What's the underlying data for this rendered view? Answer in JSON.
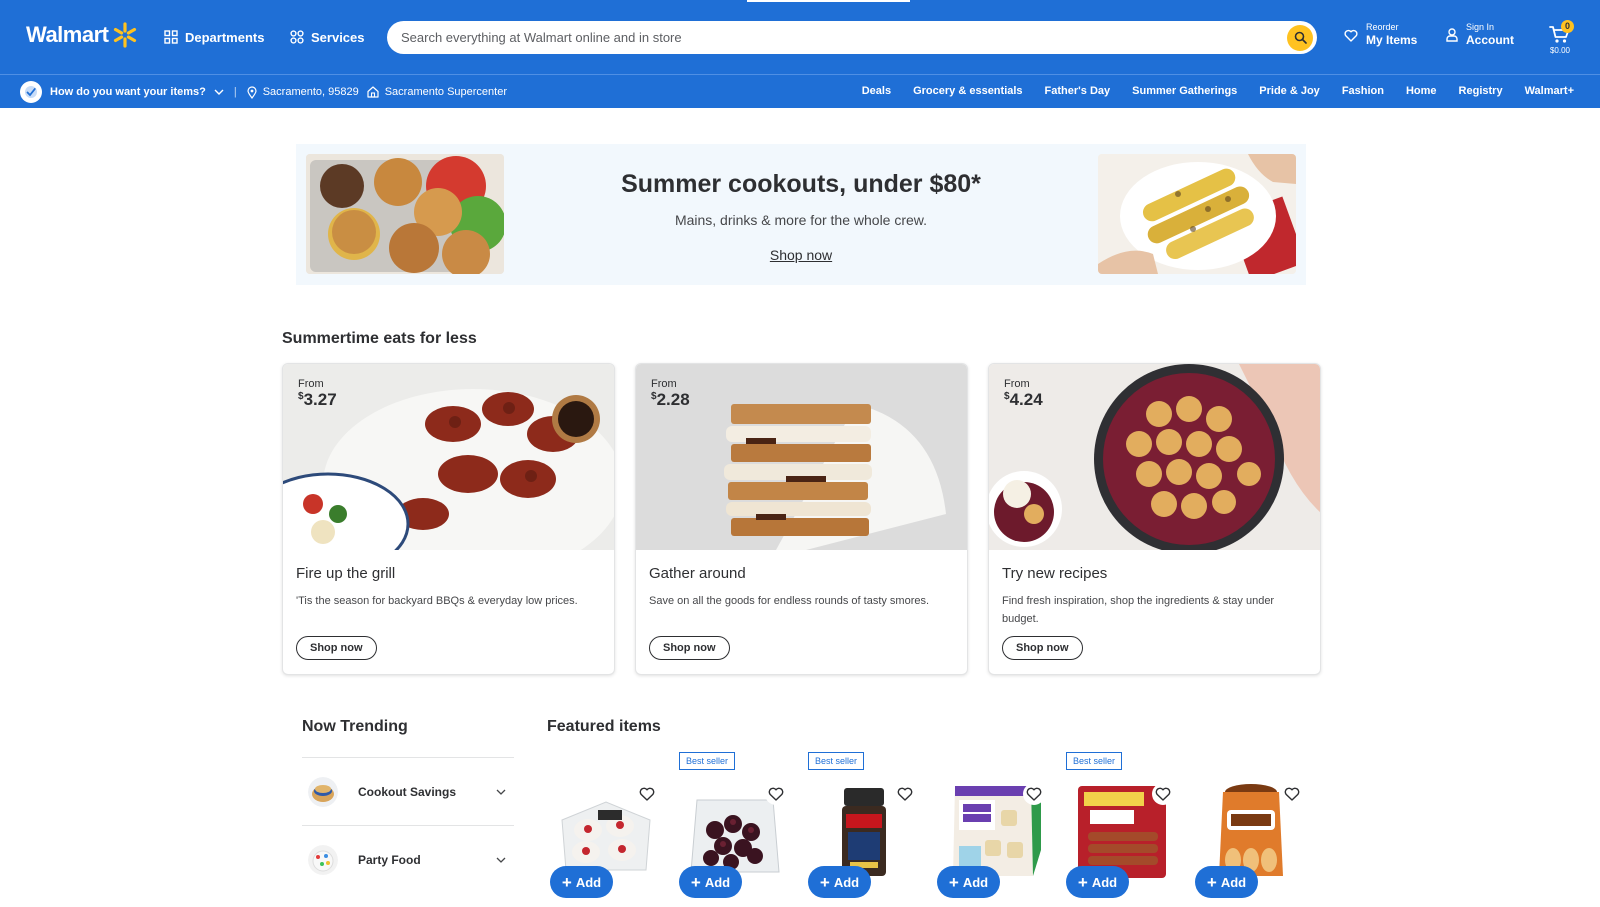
{
  "header": {
    "logo_text": "Walmart",
    "departments": "Departments",
    "services": "Services",
    "search_placeholder": "Search everything at Walmart online and in store",
    "reorder_small": "Reorder",
    "reorder_big": "My Items",
    "signin_small": "Sign In",
    "signin_big": "Account",
    "cart_count": "0",
    "cart_total": "$0.00",
    "brand_color": "#1f6fd6",
    "accent_color": "#ffc220"
  },
  "subbar": {
    "delivery_prompt": "How do you want your items?",
    "location": "Sacramento, 95829",
    "store": "Sacramento Supercenter",
    "nav": [
      "Deals",
      "Grocery & essentials",
      "Father's Day",
      "Summer Gatherings",
      "Pride & Joy",
      "Fashion",
      "Home",
      "Registry",
      "Walmart+"
    ]
  },
  "banner": {
    "title": "Summer cookouts, under $80*",
    "subtitle": "Mains, drinks & more for the whole crew.",
    "link": "Shop now"
  },
  "summertime": {
    "title": "Summertime eats for less",
    "cards": [
      {
        "from": "From",
        "currency": "$",
        "price": "3.27",
        "title": "Fire up the grill",
        "desc": "'Tis the season for backyard BBQs & everyday low prices.",
        "button": "Shop now"
      },
      {
        "from": "From",
        "currency": "$",
        "price": "2.28",
        "title": "Gather around",
        "desc": "Save on all the goods for endless rounds of tasty smores.",
        "button": "Shop now"
      },
      {
        "from": "From",
        "currency": "$",
        "price": "4.24",
        "title": "Try new recipes",
        "desc": "Find fresh inspiration, shop the ingredients & stay under budget.",
        "button": "Shop now"
      }
    ]
  },
  "trending": {
    "title": "Now Trending",
    "items": [
      {
        "label": "Cookout Savings"
      },
      {
        "label": "Party Food"
      }
    ]
  },
  "featured": {
    "title": "Featured items",
    "add_label": "Add",
    "products": [
      {
        "tag": ""
      },
      {
        "tag": "Best seller"
      },
      {
        "tag": "Best seller"
      },
      {
        "tag": ""
      },
      {
        "tag": "Best seller"
      },
      {
        "tag": ""
      }
    ]
  }
}
